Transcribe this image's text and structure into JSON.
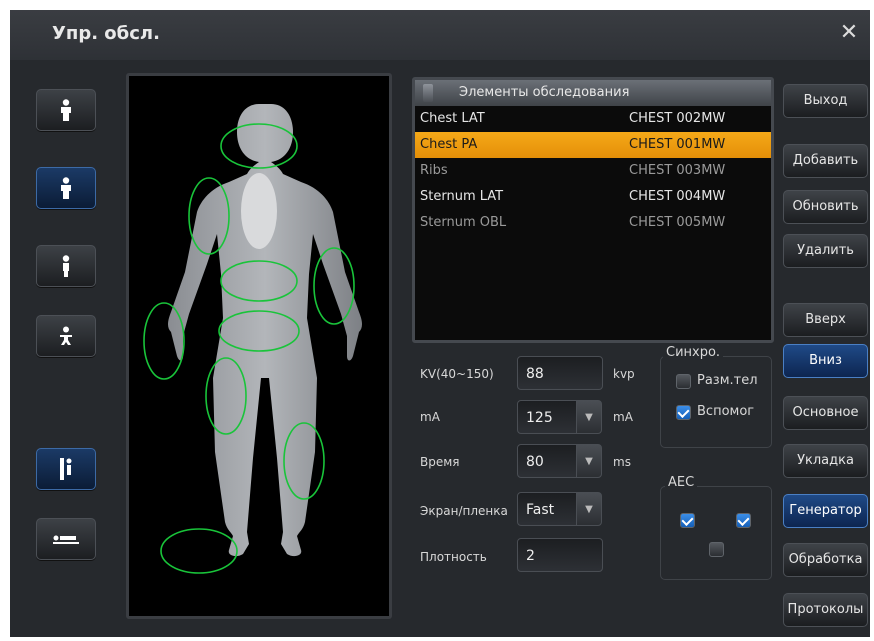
{
  "window": {
    "title": "Упр. обсл.",
    "close_icon": "close-icon"
  },
  "left_buttons": [
    {
      "icon": "person-front-icon",
      "active": false
    },
    {
      "icon": "person-front-icon",
      "active": true
    },
    {
      "icon": "person-side-icon",
      "active": false
    },
    {
      "icon": "child-icon",
      "active": false
    },
    {
      "icon": "stand-bucky-icon",
      "active": true
    },
    {
      "icon": "table-bucky-icon",
      "active": false
    }
  ],
  "exam_list": {
    "header": "Элементы обследования",
    "rows": [
      {
        "name": "Chest LAT",
        "code": "CHEST 002MW"
      },
      {
        "name": "Chest PA",
        "code": "CHEST 001MW",
        "selected": true
      },
      {
        "name": "Ribs",
        "code": "CHEST 003MW"
      },
      {
        "name": "Sternum LAT",
        "code": "CHEST 004MW"
      },
      {
        "name": "Sternum OBL",
        "code": "CHEST 005MW"
      }
    ]
  },
  "buttons": {
    "exit": "Выход",
    "add": "Добавить",
    "update": "Обновить",
    "delete": "Удалить",
    "up": "Вверх",
    "down": "Вниз",
    "basic": "Основное",
    "positioning": "Укладка",
    "generator": "Генератор",
    "processing": "Обработка",
    "protocols": "Протоколы"
  },
  "params": {
    "kv_label": "KV(40~150)",
    "kv_value": "88",
    "kv_unit": "kvp",
    "ma_label": "mA",
    "ma_value": "125",
    "ma_unit": "mA",
    "time_label": "Время",
    "time_value": "80",
    "time_unit": "ms",
    "screen_label": "Экран/пленка",
    "screen_value": "Fast",
    "density_label": "Плотность",
    "density_value": "2"
  },
  "sync": {
    "title": "Синхро.",
    "opt1_label": "Разм.тел",
    "opt1_checked": false,
    "opt2_label": "Вспомог",
    "opt2_checked": true
  },
  "aec": {
    "title": "AEC",
    "left": true,
    "right": true,
    "center": false
  }
}
